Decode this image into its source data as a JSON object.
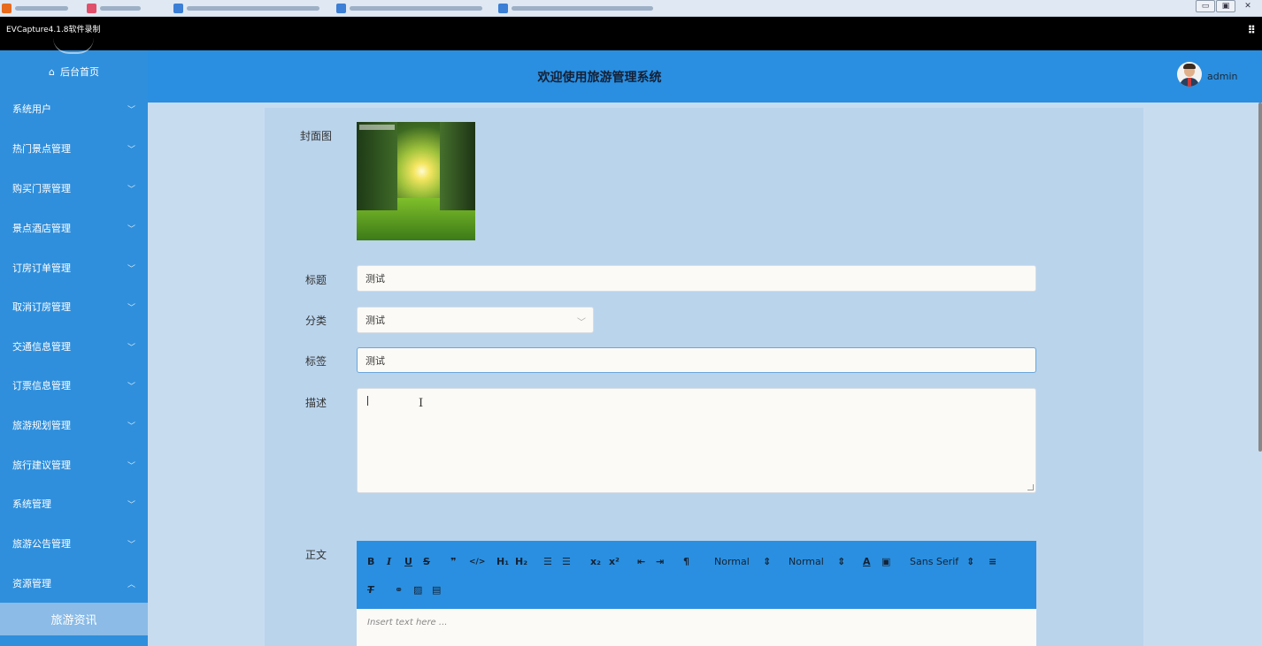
{
  "capture": {
    "title": "EVCapture4.1.8软件录制"
  },
  "header": {
    "title": "欢迎使用旅游管理系统",
    "username": "admin"
  },
  "sidebar": {
    "home_label": "后台首页",
    "items": [
      {
        "label": "系统用户",
        "expanded": false
      },
      {
        "label": "热门景点管理",
        "expanded": false
      },
      {
        "label": "购买门票管理",
        "expanded": false
      },
      {
        "label": "景点酒店管理",
        "expanded": false
      },
      {
        "label": "订房订单管理",
        "expanded": false
      },
      {
        "label": "取消订房管理",
        "expanded": false
      },
      {
        "label": "交通信息管理",
        "expanded": false
      },
      {
        "label": "订票信息管理",
        "expanded": false
      },
      {
        "label": "旅游规划管理",
        "expanded": false
      },
      {
        "label": "旅行建议管理",
        "expanded": false
      },
      {
        "label": "系统管理",
        "expanded": false
      },
      {
        "label": "旅游公告管理",
        "expanded": false
      },
      {
        "label": "资源管理",
        "expanded": true
      }
    ],
    "sub_item": "旅游资讯"
  },
  "form": {
    "cover_label": "封面图",
    "title_label": "标题",
    "title_value": "测试",
    "category_label": "分类",
    "category_value": "测试",
    "tags_label": "标签",
    "tags_value": "测试",
    "description_label": "描述",
    "description_value": "",
    "content_label": "正文"
  },
  "editor": {
    "header_select": "Normal",
    "size_select": "Normal",
    "font_select": "Sans Serif",
    "placeholder": "Insert text here ..."
  },
  "colors": {
    "sidebar": "#2f8fdc",
    "header": "#2a8fe0",
    "submenu_active": "#8bbbe6"
  }
}
